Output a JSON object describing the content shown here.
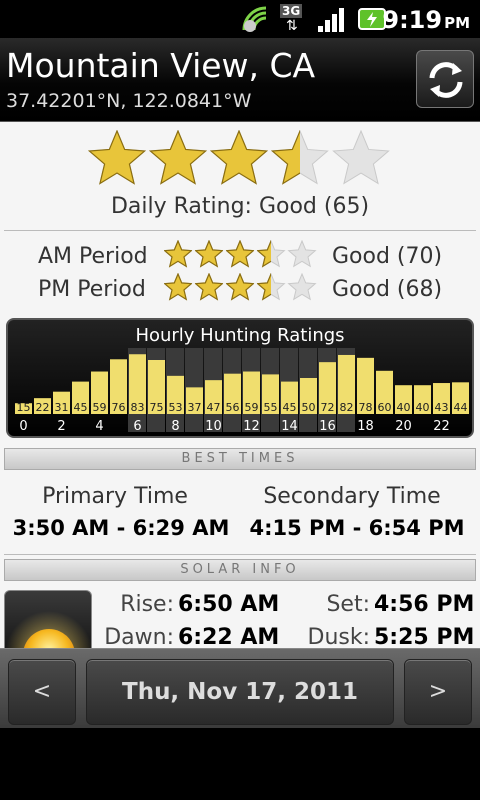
{
  "status_bar": {
    "time": "9:19",
    "ampm": "PM",
    "network": "3G"
  },
  "location": {
    "name": "Mountain View, CA",
    "coords": "37.42201°N, 122.0841°W"
  },
  "daily": {
    "stars": 3.5,
    "label": "Daily Rating: Good (65)"
  },
  "periods": [
    {
      "label": "AM Period",
      "stars": 3.5,
      "value": "Good (70)"
    },
    {
      "label": "PM Period",
      "stars": 3.5,
      "value": "Good (68)"
    }
  ],
  "hourly": {
    "title": "Hourly Hunting Ratings",
    "values": [
      15,
      22,
      31,
      45,
      59,
      76,
      83,
      75,
      53,
      37,
      47,
      56,
      59,
      55,
      45,
      50,
      72,
      82,
      78,
      60,
      40,
      40,
      43,
      44
    ],
    "highlighted_hours": [
      6,
      7,
      8,
      9,
      10,
      11,
      12,
      13,
      14,
      15,
      16,
      17
    ],
    "tick_labels": [
      "0",
      "2",
      "4",
      "6",
      "8",
      "10",
      "12",
      "14",
      "16",
      "18",
      "20",
      "22"
    ],
    "bar_color": "#f0de6e"
  },
  "best_times": {
    "header": "BEST TIMES",
    "primary_label": "Primary Time",
    "primary_value": "3:50 AM - 6:29 AM",
    "secondary_label": "Secondary Time",
    "secondary_value": "4:15 PM - 6:54 PM"
  },
  "solar": {
    "header": "SOLAR INFO",
    "rise_label": "Rise:",
    "rise_value": "6:50 AM",
    "set_label": "Set:",
    "set_value": "4:56 PM",
    "dawn_label": "Dawn:",
    "dawn_value": "6:22 AM",
    "dusk_label": "Dusk:",
    "dusk_value": "5:25 PM"
  },
  "nav": {
    "prev_label": "<",
    "date_label": "Thu, Nov 17, 2011",
    "next_label": ">"
  },
  "colors": {
    "star_gold": "#e8c53a",
    "star_empty": "#e3e3e3"
  }
}
